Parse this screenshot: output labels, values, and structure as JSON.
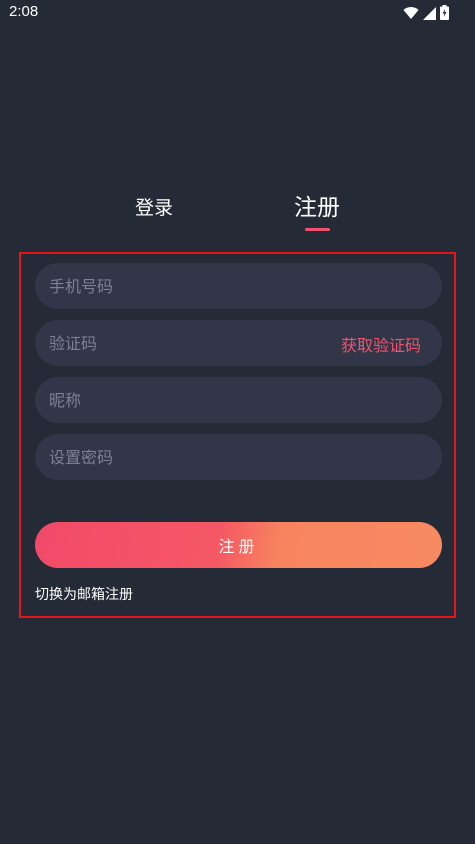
{
  "status_bar": {
    "time": "2:08"
  },
  "tabs": {
    "login_label": "登录",
    "register_label": "注册",
    "active": "register"
  },
  "form": {
    "phone_placeholder": "手机号码",
    "code_placeholder": "验证码",
    "get_code_label": "获取验证码",
    "nickname_placeholder": "昵称",
    "password_placeholder": "设置密码",
    "submit_label": "注册",
    "switch_label": "切换为邮箱注册"
  },
  "colors": {
    "background": "#252a37",
    "field_bg": "#313648",
    "accent": "#f2526c",
    "gradient_end": "#f78a60",
    "highlight_border": "#e8141b"
  }
}
